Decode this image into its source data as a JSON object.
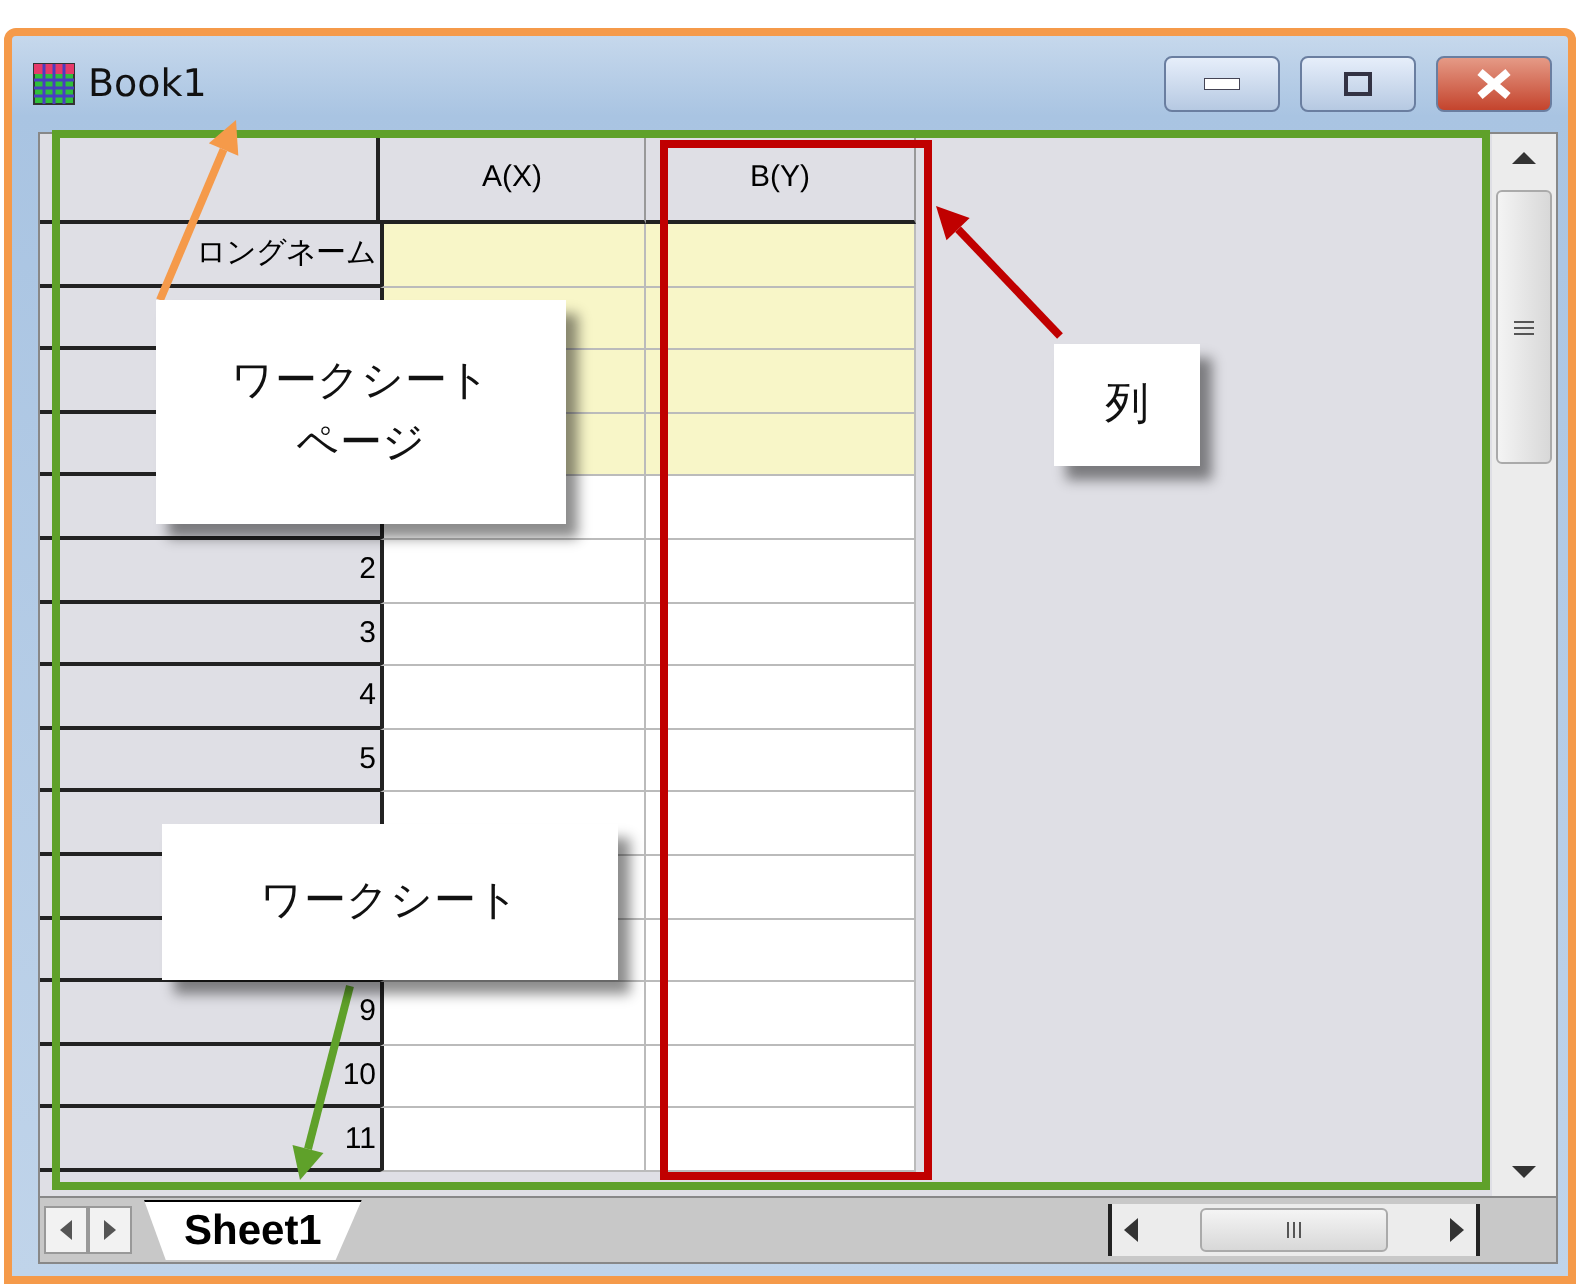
{
  "window": {
    "title": "Book1"
  },
  "worksheet": {
    "columns": [
      {
        "label": "A(X)"
      },
      {
        "label": "B(Y)"
      }
    ],
    "rows": [
      {
        "kind": "label",
        "label": "ロングネーム"
      },
      {
        "kind": "label"
      },
      {
        "kind": "label"
      },
      {
        "kind": "label"
      },
      {
        "kind": "data"
      },
      {
        "kind": "data",
        "label": "2"
      },
      {
        "kind": "data",
        "label": "3"
      },
      {
        "kind": "data",
        "label": "4"
      },
      {
        "kind": "data",
        "label": "5"
      },
      {
        "kind": "data"
      },
      {
        "kind": "data"
      },
      {
        "kind": "data"
      },
      {
        "kind": "data",
        "label": "9"
      },
      {
        "kind": "data",
        "label": "10"
      },
      {
        "kind": "data",
        "label": "11"
      }
    ]
  },
  "sheet_tabs": [
    {
      "label": "Sheet1",
      "selected": true
    }
  ],
  "callouts": [
    {
      "kind": "page",
      "text": "ワークシートページ"
    },
    {
      "kind": "column",
      "text": "列"
    },
    {
      "kind": "sheet",
      "text": "ワークシート"
    }
  ]
}
